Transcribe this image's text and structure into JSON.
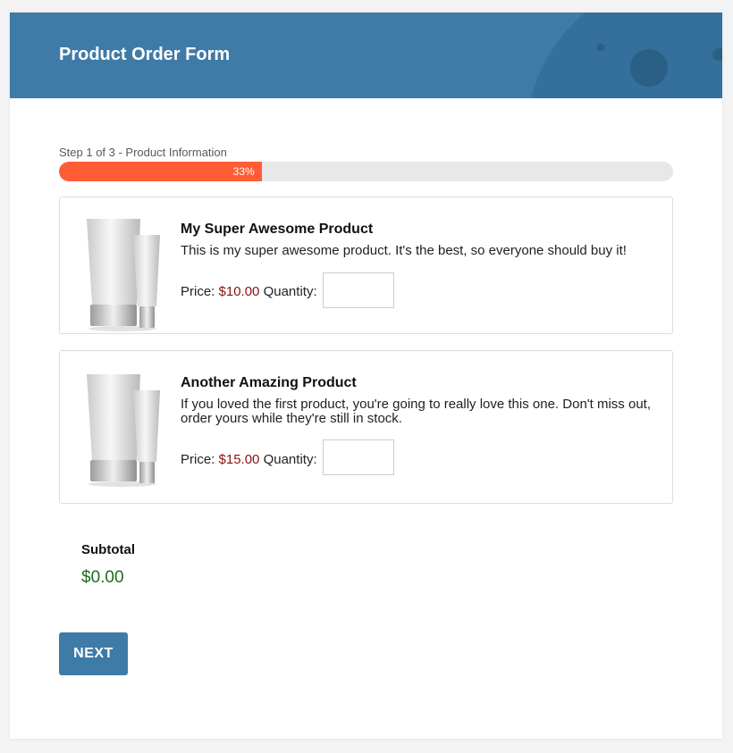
{
  "header": {
    "title": "Product Order Form"
  },
  "progress": {
    "step_label": "Step 1 of 3 - Product Information",
    "percent_label": "33%",
    "fraction": 0.33
  },
  "products": [
    {
      "name": "My Super Awesome Product",
      "description": "This is my super awesome product. It's the best, so everyone should buy it!",
      "price_label": "Price:",
      "price": "$10.00",
      "quantity_label": "Quantity:",
      "quantity_value": ""
    },
    {
      "name": "Another Amazing Product",
      "description": "If you loved the first product, you're going to really love this one. Don't miss out, order yours while they're still in stock.",
      "price_label": "Price:",
      "price": "$15.00",
      "quantity_label": "Quantity:",
      "quantity_value": ""
    }
  ],
  "subtotal": {
    "label": "Subtotal",
    "value": "$0.00"
  },
  "actions": {
    "next_label": "NEXT"
  },
  "colors": {
    "brand": "#3e7ba7",
    "progress": "#ff5c35",
    "price": "#8b1111",
    "subtotal": "#1d6b1d"
  },
  "icons": {
    "product_image": "cosmetic-tubes-image"
  }
}
